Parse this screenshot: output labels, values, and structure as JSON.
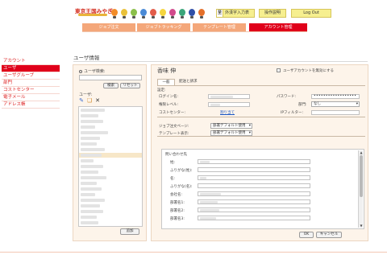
{
  "header": {
    "logo_text": "東京王国みやぎ",
    "kanji_button": "至",
    "kanji_label": "外漢字入力表",
    "help_button": "操作説明",
    "logout_button": "Log Out"
  },
  "colors": {
    "brand_red": "#e0001a",
    "tab_orange": "#f4a77a",
    "panel_bg": "#fdf4ea",
    "link_blue": "#1a56c4"
  },
  "nav": {
    "tabs": [
      {
        "label": "ジョブ注文"
      },
      {
        "label": "ジョブトラッキング"
      },
      {
        "label": "テンプレート管理"
      },
      {
        "label": "アカウント管理"
      }
    ]
  },
  "sidebar": {
    "items": [
      {
        "label": "アカウント"
      },
      {
        "label": "ユーザ"
      },
      {
        "label": "ユーザグループ"
      },
      {
        "label": "部門"
      },
      {
        "label": "コストセンター"
      },
      {
        "label": "電子メール"
      },
      {
        "label": "アドレス帳"
      }
    ]
  },
  "page": {
    "title": "ユーザ情報"
  },
  "search": {
    "label": "ユーザ検索:",
    "placeholder": "",
    "search_button": "検索",
    "reset_button": "リセット",
    "users_label": "ユーザ:",
    "add_button": "追加"
  },
  "detail": {
    "user_name": "香味 伸",
    "disable_label": "ユーザアカウントを無効にする",
    "tab_general": "一般",
    "tab_delivery": "配送と請求",
    "settings_label": "設定:",
    "login_label": "ログイン名:",
    "permission_label": "権限レベル:",
    "cost_center_label": "コストセンター:",
    "cost_center_link": "割り当て",
    "password_label": "パスワード:",
    "password_value": "••••••••••••••••••",
    "department_label": "部門:",
    "department_value": "なし",
    "ip_filter_label": "IPフィルター:",
    "job_order_page_label": "ジョブ注文ページ:",
    "job_order_page_value": "部署デフォルト使用",
    "template_display_label": "テンプレート表示:",
    "template_display_value": "部署デフォルト使用",
    "contact_title": "問い合わせ先",
    "contact_fields": [
      {
        "label": "姓:"
      },
      {
        "label": "ふりがな(姓):"
      },
      {
        "label": "名:"
      },
      {
        "label": "ふりがな(名):"
      },
      {
        "label": "会社名:"
      },
      {
        "label": "部署名1:"
      },
      {
        "label": "部署名2:"
      },
      {
        "label": "部署名3:"
      }
    ],
    "ok_button": "OK",
    "cancel_button": "キャンセル"
  }
}
